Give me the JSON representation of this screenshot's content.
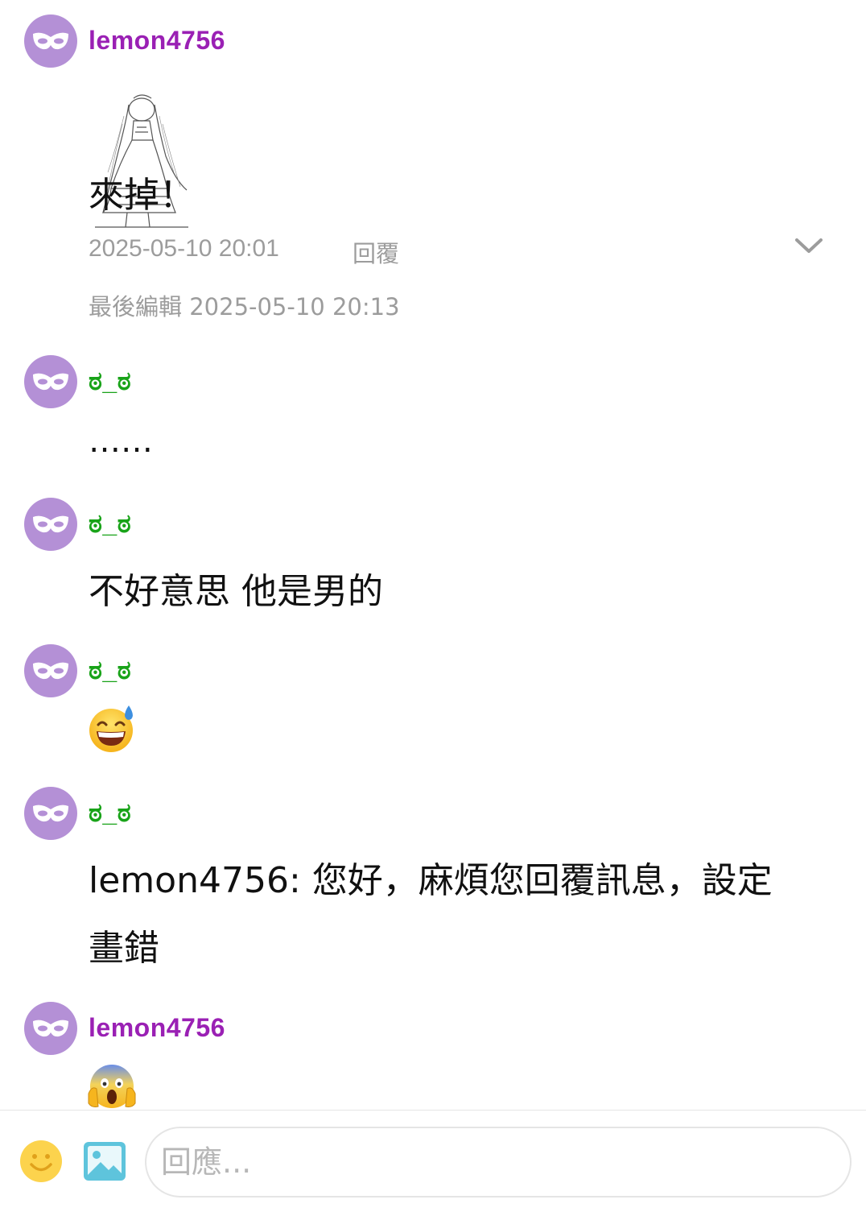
{
  "comments": [
    {
      "username": "lemon4756",
      "username_color": "#9a20b4",
      "sticker": "anime-maid-girl-sketch",
      "text": "來掉！",
      "timestamp": "2025-05-10 20:01",
      "reply_label": "回覆",
      "edited": "最後編輯 2025-05-10 20:13"
    },
    {
      "username": "ಠ_ಠ",
      "username_color": "#19a319",
      "text": "……"
    },
    {
      "username": "ಠ_ಠ",
      "username_color": "#19a319",
      "text": "不好意思 他是男的"
    },
    {
      "username": "ಠ_ಠ",
      "username_color": "#19a319",
      "emoji": "grinning-face-with-sweat"
    },
    {
      "username": "ಠ_ಠ",
      "username_color": "#19a319",
      "text_line1": "lemon4756: 您好，麻煩您回覆訊息，設定",
      "text_line2": "畫錯"
    },
    {
      "username": "lemon4756",
      "username_color": "#9a20b4",
      "emoji": "face-screaming-in-fear"
    }
  ],
  "composer": {
    "placeholder": "回應...",
    "icons": [
      "smiley-icon",
      "image-icon"
    ]
  },
  "colors": {
    "avatar": "#b490d6",
    "meta_gray": "#9c9c9c"
  }
}
